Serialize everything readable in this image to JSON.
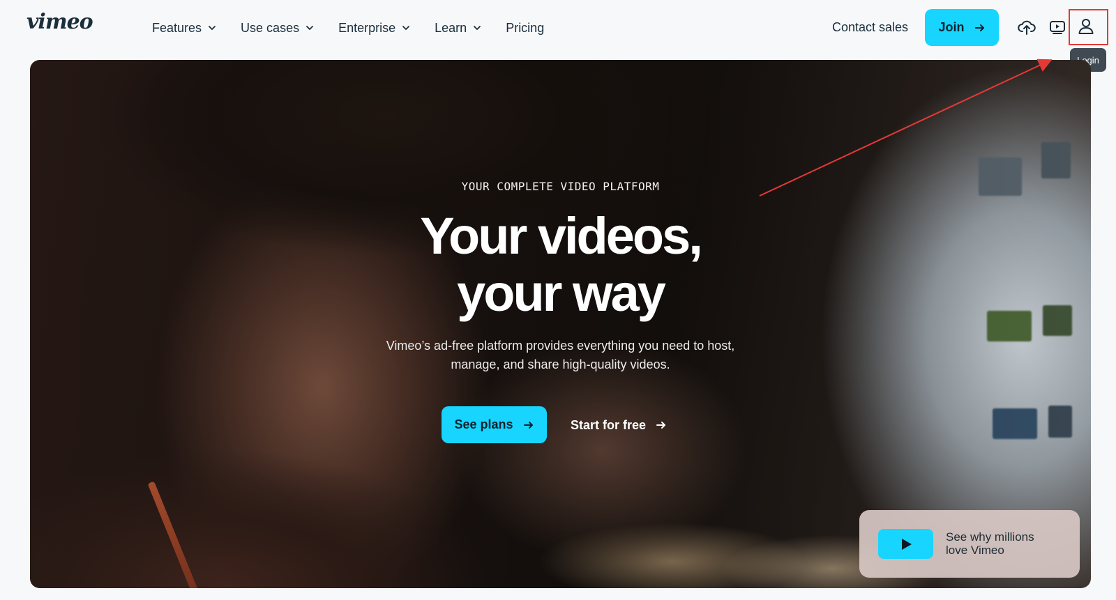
{
  "brand": {
    "logo": "vimeo"
  },
  "nav": {
    "menu": [
      {
        "label": "Features",
        "dropdown": true
      },
      {
        "label": "Use cases",
        "dropdown": true
      },
      {
        "label": "Enterprise",
        "dropdown": true
      },
      {
        "label": "Learn",
        "dropdown": true
      },
      {
        "label": "Pricing",
        "dropdown": false
      }
    ],
    "contact_sales": "Contact sales",
    "join_label": "Join",
    "icons": [
      "upload-icon",
      "video-player-icon",
      "user-icon"
    ],
    "login_tooltip": "Login"
  },
  "hero": {
    "kicker": "YOUR COMPLETE VIDEO PLATFORM",
    "headline_line1": "Your videos,",
    "headline_line2": "your way",
    "sub_line1": "Vimeo’s ad-free platform provides everything you need to host,",
    "sub_line2": "manage, and share high-quality videos.",
    "see_plans": "See plans",
    "start_free": "Start for free"
  },
  "promo": {
    "line1": "See why millions",
    "line2": "love Vimeo"
  },
  "colors": {
    "accent": "#17d5ff",
    "annotation": "#e53935",
    "text_dark": "#1a2e3b"
  }
}
